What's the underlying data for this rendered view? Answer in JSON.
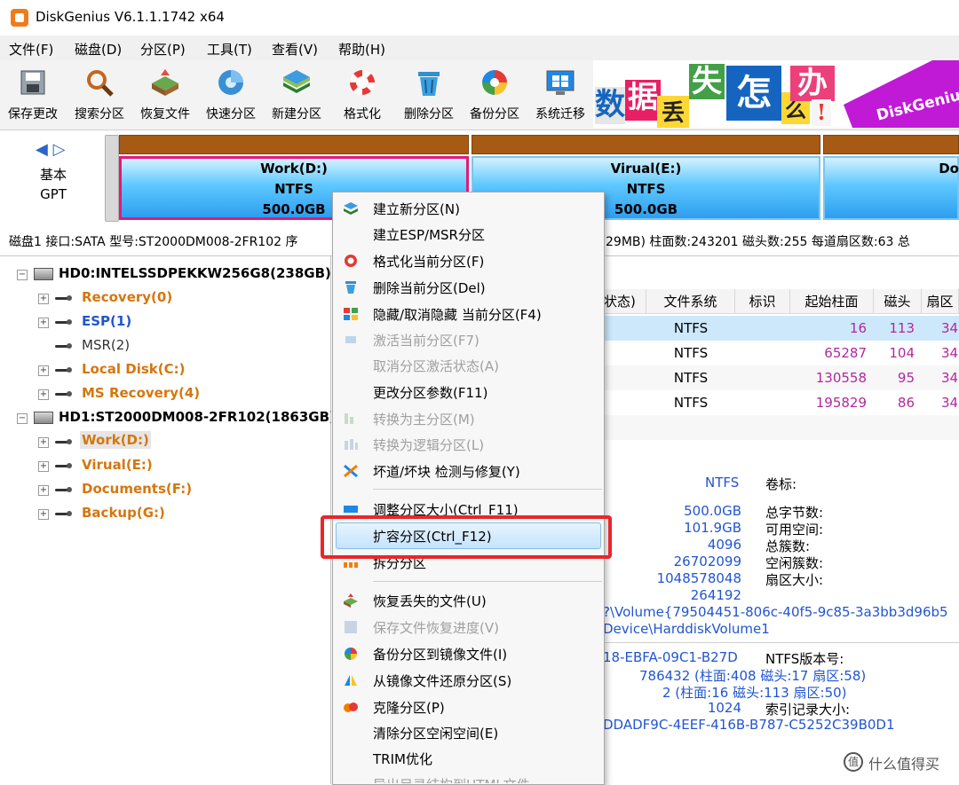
{
  "window": {
    "title": "DiskGenius V6.1.1.1742 x64"
  },
  "menu": [
    "文件(F)",
    "磁盘(D)",
    "分区(P)",
    "工具(T)",
    "查看(V)",
    "帮助(H)"
  ],
  "toolbar": [
    {
      "label": "保存更改",
      "icon": "save-disk-icon"
    },
    {
      "label": "搜索分区",
      "icon": "magnifier-icon"
    },
    {
      "label": "恢复文件",
      "icon": "recover-files-icon"
    },
    {
      "label": "快速分区",
      "icon": "quick-partition-icon"
    },
    {
      "label": "新建分区",
      "icon": "layers-icon"
    },
    {
      "label": "格式化",
      "icon": "lifebuoy-icon"
    },
    {
      "label": "删除分区",
      "icon": "trash-icon"
    },
    {
      "label": "备份分区",
      "icon": "pie-icon"
    },
    {
      "label": "系统迁移",
      "icon": "windows-icon"
    }
  ],
  "ad_banner": {
    "chars": [
      "数",
      "据",
      "丢",
      "失",
      "怎",
      "么",
      "办",
      "!"
    ],
    "brand": "DiskGenius"
  },
  "disk_map": {
    "nav": "◀ ▷",
    "type_line1": "基本",
    "type_line2": "GPT",
    "partitions": [
      {
        "name": "Work(D:)",
        "fs": "NTFS",
        "size": "500.0GB"
      },
      {
        "name": "Virual(E:)",
        "fs": "NTFS",
        "size": "500.0GB"
      },
      {
        "name": "Do",
        "fs": "",
        "size": ""
      }
    ]
  },
  "disk_info": {
    "left": "磁盘1 接口:SATA  型号:ST2000DM008-2FR102  序",
    "right": "29MB)  柱面数:243201  磁头数:255  每道扇区数:63  总"
  },
  "tree": {
    "hd0": "HD0:INTELSSDPEKKW256G8(238GB)",
    "hd0_parts": [
      "Recovery(0)",
      "ESP(1)",
      "MSR(2)",
      "Local Disk(C:)",
      "MS Recovery(4)"
    ],
    "hd1": "HD1:ST2000DM008-2FR102(1863GB)",
    "hd1_parts": [
      "Work(D:)",
      "Virual(E:)",
      "Documents(F:)",
      "Backup(G:)"
    ]
  },
  "table": {
    "headers": [
      "状态)",
      "文件系统",
      "标识",
      "起始柱面",
      "磁头",
      "扇区"
    ],
    "rows": [
      {
        "fs": "NTFS",
        "start": "16",
        "head": "113",
        "sector": "34"
      },
      {
        "fs": "NTFS",
        "start": "65287",
        "head": "104",
        "sector": "34"
      },
      {
        "fs": "NTFS",
        "start": "130558",
        "head": "95",
        "sector": "34"
      },
      {
        "fs": "NTFS",
        "start": "195829",
        "head": "86",
        "sector": "34"
      }
    ]
  },
  "details": {
    "fs_value": "NTFS",
    "volume_label": "卷标:",
    "values": [
      "500.0GB",
      "101.9GB",
      "4096",
      "26702099",
      "1048578048",
      "264192"
    ],
    "labels": [
      "总字节数:",
      "可用空间:",
      "总簇数:",
      "空闲簇数:",
      "扇区大小:"
    ],
    "guid_path": "?\\Volume{79504451-806c-40f5-9c85-3a3bb3d96b5",
    "device_path": "Device\\HarddiskVolume1",
    "serial": "18-EBFA-09C1-B27D",
    "ntfs_version_label": "NTFS版本号:",
    "mft_line": "786432 (柱面:408 磁头:17 扇区:58)",
    "mftmirr_line": "2 (柱面:16 磁头:113 扇区:50)",
    "index_value": "1024",
    "index_label": "索引记录大小:",
    "guid2": "DDADF9C-4EEF-416B-B787-C5252C39B0D1"
  },
  "context_menu": {
    "items": [
      {
        "label": "建立新分区(N)",
        "enabled": true,
        "icon": "new-partition-icon"
      },
      {
        "label": "建立ESP/MSR分区",
        "enabled": true,
        "icon": ""
      },
      {
        "label": "格式化当前分区(F)",
        "enabled": true,
        "icon": "format-icon"
      },
      {
        "label": "删除当前分区(Del)",
        "enabled": true,
        "icon": "delete-icon"
      },
      {
        "label": "隐藏/取消隐藏 当前分区(F4)",
        "enabled": true,
        "icon": "hide-icon"
      },
      {
        "label": "激活当前分区(F7)",
        "enabled": false,
        "icon": "activate-icon"
      },
      {
        "label": "取消分区激活状态(A)",
        "enabled": false,
        "icon": ""
      },
      {
        "label": "更改分区参数(F11)",
        "enabled": true,
        "icon": ""
      },
      {
        "label": "转换为主分区(M)",
        "enabled": false,
        "icon": "primary-icon"
      },
      {
        "label": "转换为逻辑分区(L)",
        "enabled": false,
        "icon": "logical-icon"
      },
      {
        "label": "坏道/坏块 检测与修复(Y)",
        "enabled": true,
        "icon": "tools-icon"
      },
      {
        "label": "调整分区大小(Ctrl_F11)",
        "enabled": true,
        "icon": "resize-icon"
      },
      {
        "label": "扩容分区(Ctrl_F12)",
        "enabled": true,
        "icon": "",
        "highlighted": true
      },
      {
        "label": "拆分分区",
        "enabled": true,
        "icon": "split-icon"
      },
      {
        "label": "恢复丢失的文件(U)",
        "enabled": true,
        "icon": "recover-icon"
      },
      {
        "label": "保存文件恢复进度(V)",
        "enabled": false,
        "icon": "save-progress-icon"
      },
      {
        "label": "备份分区到镜像文件(I)",
        "enabled": true,
        "icon": "backup-icon"
      },
      {
        "label": "从镜像文件还原分区(S)",
        "enabled": true,
        "icon": "restore-icon"
      },
      {
        "label": "克隆分区(P)",
        "enabled": true,
        "icon": "clone-icon"
      },
      {
        "label": "清除分区空闲空间(E)",
        "enabled": true,
        "icon": ""
      },
      {
        "label": "TRIM优化",
        "enabled": true,
        "icon": ""
      },
      {
        "label": "导出目录结构到HTML文件",
        "enabled": false,
        "icon": ""
      }
    ]
  },
  "watermark": {
    "icon": "值",
    "text": "什么值得买"
  }
}
